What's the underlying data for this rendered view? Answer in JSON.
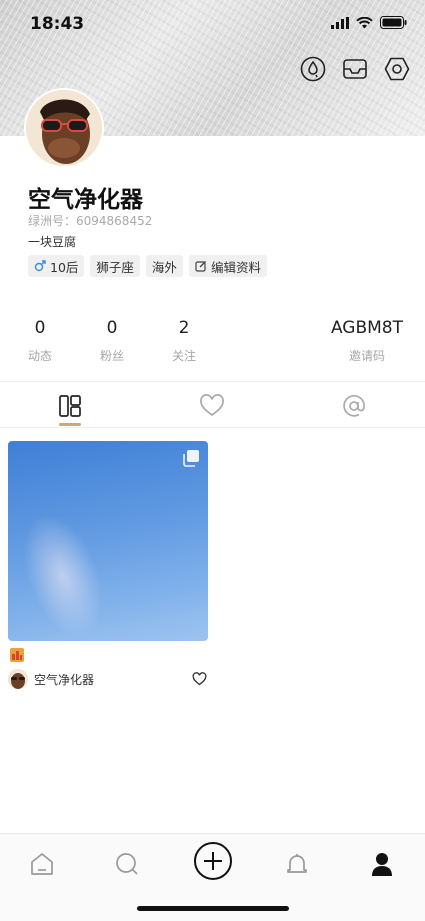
{
  "status_bar": {
    "time": "18:43"
  },
  "profile": {
    "name": "空气净化器",
    "uid": "绿洲号：6094868452",
    "bio": "一块豆腐",
    "tags": [
      {
        "label": "10后",
        "icon": "male-icon"
      },
      {
        "label": "狮子座"
      },
      {
        "label": "海外"
      },
      {
        "label": "编辑资料",
        "icon": "edit-icon"
      }
    ]
  },
  "stats": [
    {
      "value": "0",
      "label": "动态"
    },
    {
      "value": "0",
      "label": "粉丝"
    },
    {
      "value": "2",
      "label": "关注"
    },
    {
      "value": "AGBM8T",
      "label": "邀请码"
    }
  ],
  "tabs": [
    {
      "icon": "grid-icon",
      "active": true
    },
    {
      "icon": "heart-icon",
      "active": false
    },
    {
      "icon": "at-icon",
      "active": false
    }
  ],
  "post": {
    "author": "空气净化器"
  },
  "bottom_nav": [
    "home-icon",
    "search-icon",
    "add-icon",
    "bell-icon",
    "profile-icon"
  ],
  "colors": {
    "accent": "#c9a977"
  }
}
